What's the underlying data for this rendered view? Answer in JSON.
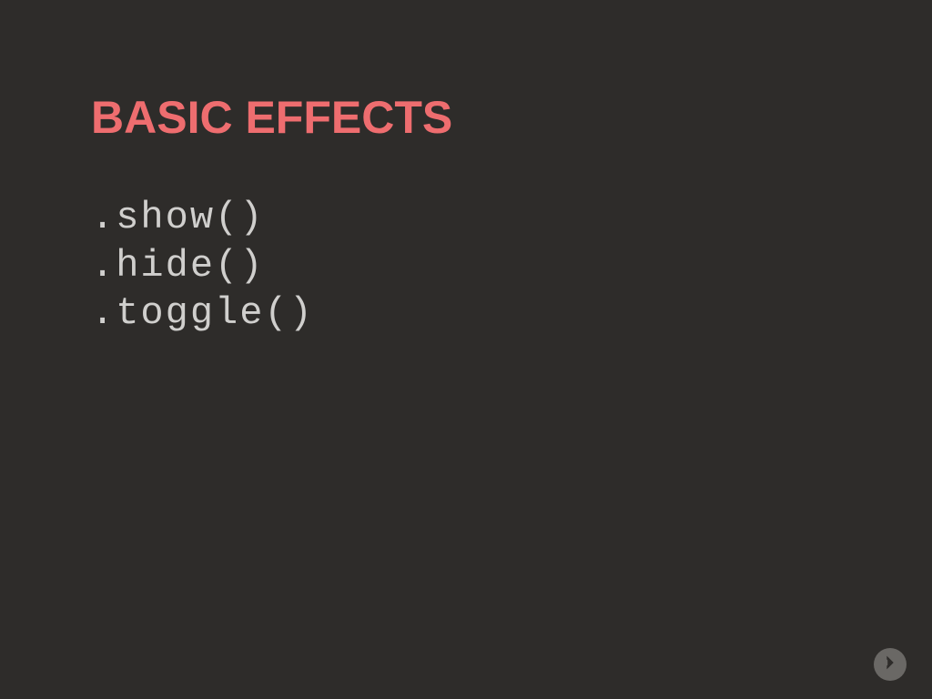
{
  "title": "BASIC EFFECTS",
  "code": {
    "line1": ".show()",
    "line2": ".hide()",
    "line3": ".toggle()"
  }
}
